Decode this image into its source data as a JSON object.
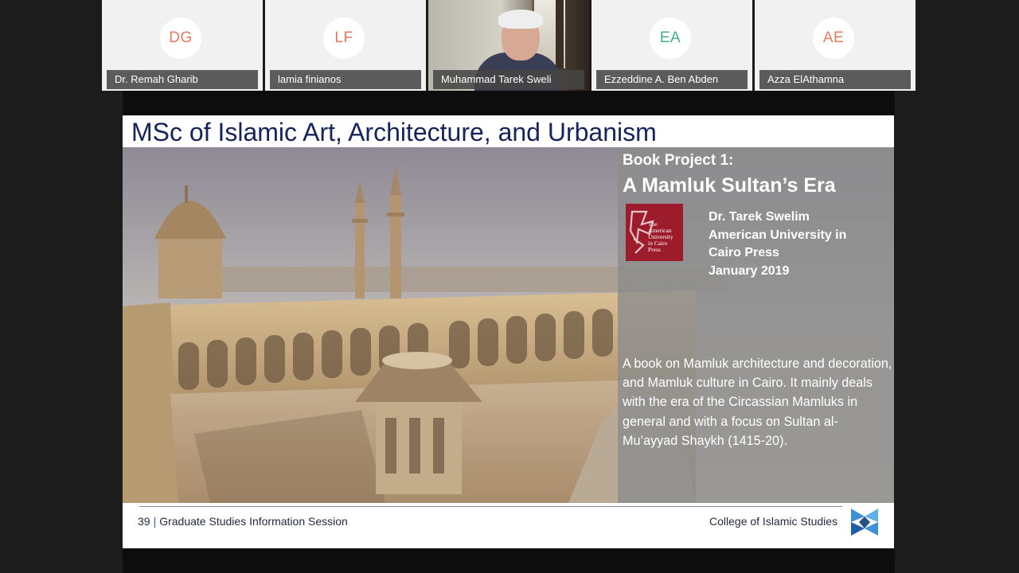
{
  "participants": [
    {
      "initials": "DG",
      "name": "Dr. Remah Gharib",
      "color": "#e8795e"
    },
    {
      "initials": "LF",
      "name": "lamia finianos",
      "color": "#e8795e"
    },
    {
      "initials": "",
      "name": "Muhammad Tarek Sweli",
      "color": ""
    },
    {
      "initials": "EA",
      "name": "Ezzeddine A. Ben Abden",
      "color": "#3fae8c"
    },
    {
      "initials": "AE",
      "name": "Azza ElAthamna",
      "color": "#e8795e"
    }
  ],
  "slide": {
    "title": "MSc of Islamic Art, Architecture, and Urbanism",
    "book_label": "Book Project 1:",
    "book_title": "A Mamluk Sultan’s Era",
    "press_logo_lines": [
      "The",
      "American",
      "University",
      "in Cairo",
      "Press"
    ],
    "author_lines": [
      "Dr. Tarek Swelim",
      "American University in",
      "Cairo Press",
      "January 2019"
    ],
    "description": "A book on Mamluk architecture and decoration, and Mamluk culture in Cairo. It  mainly deals with the era of the Circassian Mamluks in general and with a focus on Sultan al-Mu’ayyad Shaykh (1415-20).",
    "page_number": "39",
    "footer_separator": "|",
    "footer_left": "Graduate Studies Information Session",
    "footer_right": "College of Islamic Studies"
  },
  "colors": {
    "title": "#16245b",
    "press_logo": "#9d1c2c",
    "college_logo": "#3f8fd6"
  }
}
